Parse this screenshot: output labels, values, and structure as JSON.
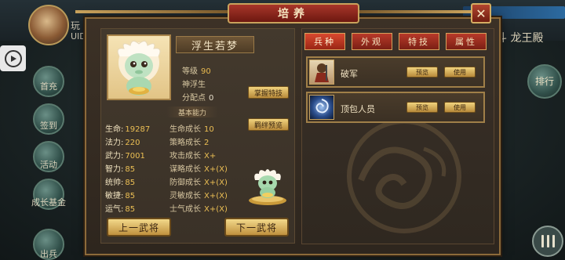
{
  "background": {
    "uid_line1": "玩",
    "uid_line2": "UID",
    "right_title": "斗 龙王殿",
    "right_button_label": "排行",
    "side_buttons": [
      "首充",
      "签到",
      "活动",
      "成长基金",
      "出兵"
    ]
  },
  "panel": {
    "title": "培养",
    "close_label": "✕"
  },
  "hero": {
    "name": "浮生若梦",
    "level_label": "等级",
    "level_value": "90",
    "title_text": "神浮生",
    "points_label": "分配点",
    "points_value": "0"
  },
  "buttons": {
    "skill": "掌握特技",
    "bond": "羁绊预览",
    "prev": "上一武将",
    "next": "下一武将"
  },
  "section_label": "基本能力",
  "stats": [
    {
      "label": "生命:",
      "value": "19287"
    },
    {
      "label": "法力:",
      "value": "220"
    },
    {
      "label": "武力:",
      "value": "7001"
    },
    {
      "label": "智力:",
      "value": "85"
    },
    {
      "label": "统帅:",
      "value": "85"
    },
    {
      "label": "敏捷:",
      "value": "85"
    },
    {
      "label": "运气:",
      "value": "85"
    }
  ],
  "growth": [
    {
      "label": "生命成长",
      "value": "10"
    },
    {
      "label": "策略成长",
      "value": "2"
    },
    {
      "label": "攻击成长",
      "value": "X+"
    },
    {
      "label": "谋略成长",
      "value": "X+(X)"
    },
    {
      "label": "防御成长",
      "value": "X+(X)"
    },
    {
      "label": "灵敏成长",
      "value": "X+(X)"
    },
    {
      "label": "士气成长",
      "value": "X+(X)"
    }
  ],
  "tabs": [
    "兵种",
    "外观",
    "特技",
    "属性"
  ],
  "items": [
    {
      "name": "破军",
      "preview": "预览",
      "use": "使用",
      "icon": "warrior-icon"
    },
    {
      "name": "顶包人员",
      "preview": "预览",
      "use": "使用",
      "icon": "vortex-icon"
    }
  ],
  "colors": {
    "accent_red": "#b93a2a",
    "gold": "#ecbf54",
    "panel_bg": "#3c3126"
  }
}
